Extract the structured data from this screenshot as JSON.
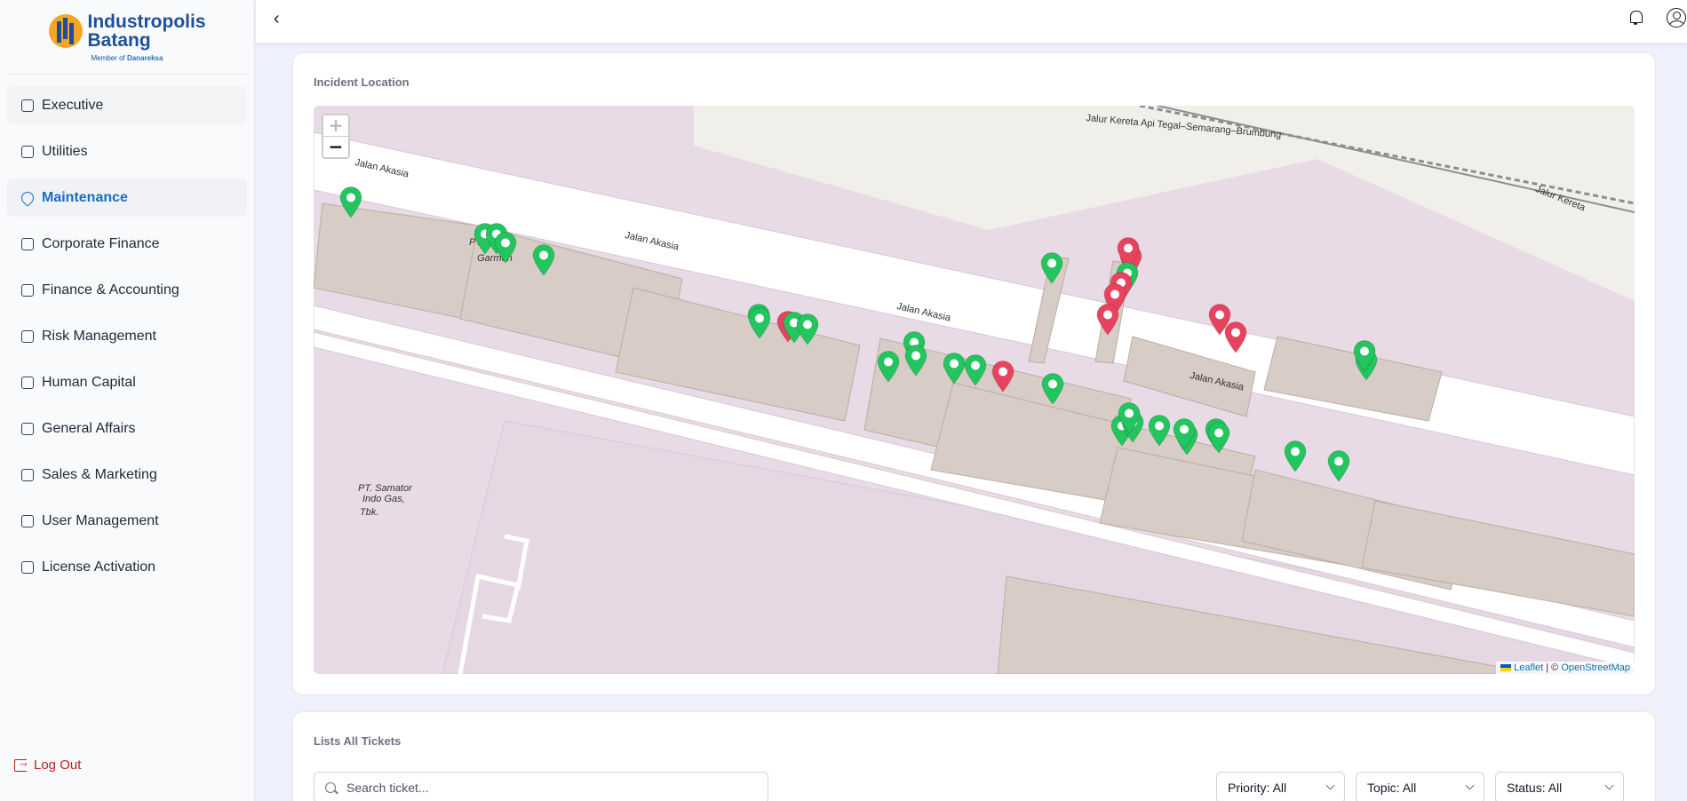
{
  "brand": {
    "name_line1": "Industropolis",
    "name_line2": "Batang",
    "member_prefix": "Member of",
    "member_org": "Danareksa"
  },
  "sidebar": {
    "items": [
      {
        "id": "executive",
        "label": "Executive"
      },
      {
        "id": "utilities",
        "label": "Utilities"
      },
      {
        "id": "maintenance",
        "label": "Maintenance",
        "active": true
      },
      {
        "id": "corporate-finance",
        "label": "Corporate Finance"
      },
      {
        "id": "finance-accounting",
        "label": "Finance & Accounting"
      },
      {
        "id": "risk-management",
        "label": "Risk Management"
      },
      {
        "id": "human-capital",
        "label": "Human Capital"
      },
      {
        "id": "general-affairs",
        "label": "General Affairs"
      },
      {
        "id": "sales-marketing",
        "label": "Sales & Marketing"
      },
      {
        "id": "user-management",
        "label": "User Management"
      },
      {
        "id": "license-activation",
        "label": "License Activation"
      }
    ],
    "logout_label": "Log Out"
  },
  "topbar": {
    "back_icon": "chevron-left-icon",
    "notification_icon": "bell-icon",
    "profile_icon": "user-circle-icon"
  },
  "map_card": {
    "title": "Incident Location",
    "zoom_in": "+",
    "zoom_out": "−",
    "attribution": {
      "leaflet": "Leaflet",
      "separator": "| ©",
      "osm": "OpenStreetMap"
    },
    "map_labels": {
      "road": "Jalan Akasia",
      "railway": "Jalur Kereta Api Tegal–Semarang–Brumbung",
      "railway_short": "Jalur Kereta",
      "poi_1": "PT. S",
      "poi_1b": "Garmen",
      "poi_2_line1": "PT. Samator",
      "poi_2_line2": "Indo Gas,",
      "poi_2_line3": "Tbk."
    },
    "marker_colors": {
      "green": "#22c55e",
      "red": "#e8435e"
    },
    "markers": [
      {
        "status": "green"
      },
      {
        "status": "green"
      },
      {
        "status": "green"
      },
      {
        "status": "green"
      },
      {
        "status": "green"
      },
      {
        "status": "green"
      },
      {
        "status": "green"
      },
      {
        "status": "red"
      },
      {
        "status": "green"
      },
      {
        "status": "green"
      },
      {
        "status": "green"
      },
      {
        "status": "green"
      },
      {
        "status": "green"
      },
      {
        "status": "green"
      },
      {
        "status": "green"
      },
      {
        "status": "red"
      },
      {
        "status": "green"
      },
      {
        "status": "green"
      },
      {
        "status": "red"
      },
      {
        "status": "red"
      },
      {
        "status": "green"
      },
      {
        "status": "red"
      },
      {
        "status": "red"
      },
      {
        "status": "red"
      },
      {
        "status": "red"
      },
      {
        "status": "red"
      },
      {
        "status": "green"
      },
      {
        "status": "green"
      },
      {
        "status": "green"
      },
      {
        "status": "green"
      },
      {
        "status": "green"
      },
      {
        "status": "green"
      },
      {
        "status": "green"
      },
      {
        "status": "green"
      },
      {
        "status": "green"
      },
      {
        "status": "green"
      },
      {
        "status": "green"
      },
      {
        "status": "green"
      }
    ]
  },
  "tickets_card": {
    "title": "Lists All Tickets",
    "search_placeholder": "Search ticket...",
    "filters": {
      "priority": "Priority: All",
      "topic": "Topic: All",
      "status": "Status: All"
    }
  }
}
